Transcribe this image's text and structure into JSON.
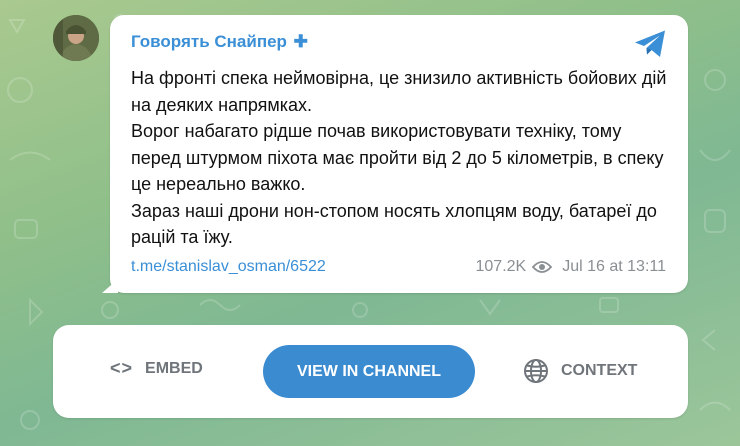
{
  "post": {
    "channel_name": "Говорять Снайпер",
    "channel_badge": "✚",
    "text_lines": [
      "На фронті спека неймовірна, це знизило активність бойових дій на деяких напрямках.",
      "Ворог набагато рідше почав використовувати техніку, тому перед штурмом піхота має пройти від 2 до 5 кілометрів, в спеку це нереально важко.",
      "Зараз наші дрони нон-стопом носять хлопцям воду, батареї до рацій та їжу."
    ],
    "link": "t.me/stanislav_osman/6522",
    "views": "107.2K",
    "date": "Jul 16 at 13:11"
  },
  "actions": {
    "embed_icon": "<>",
    "embed_label": "EMBED",
    "view_label": "VIEW IN CHANNEL",
    "context_label": "CONTEXT"
  },
  "icons": {
    "telegram": "telegram-icon",
    "eye": "eye-icon",
    "globe": "globe-icon",
    "code": "code-icon"
  },
  "colors": {
    "accent": "#3a8fd6",
    "button": "#3b8bd1",
    "muted": "#8a8f94"
  }
}
